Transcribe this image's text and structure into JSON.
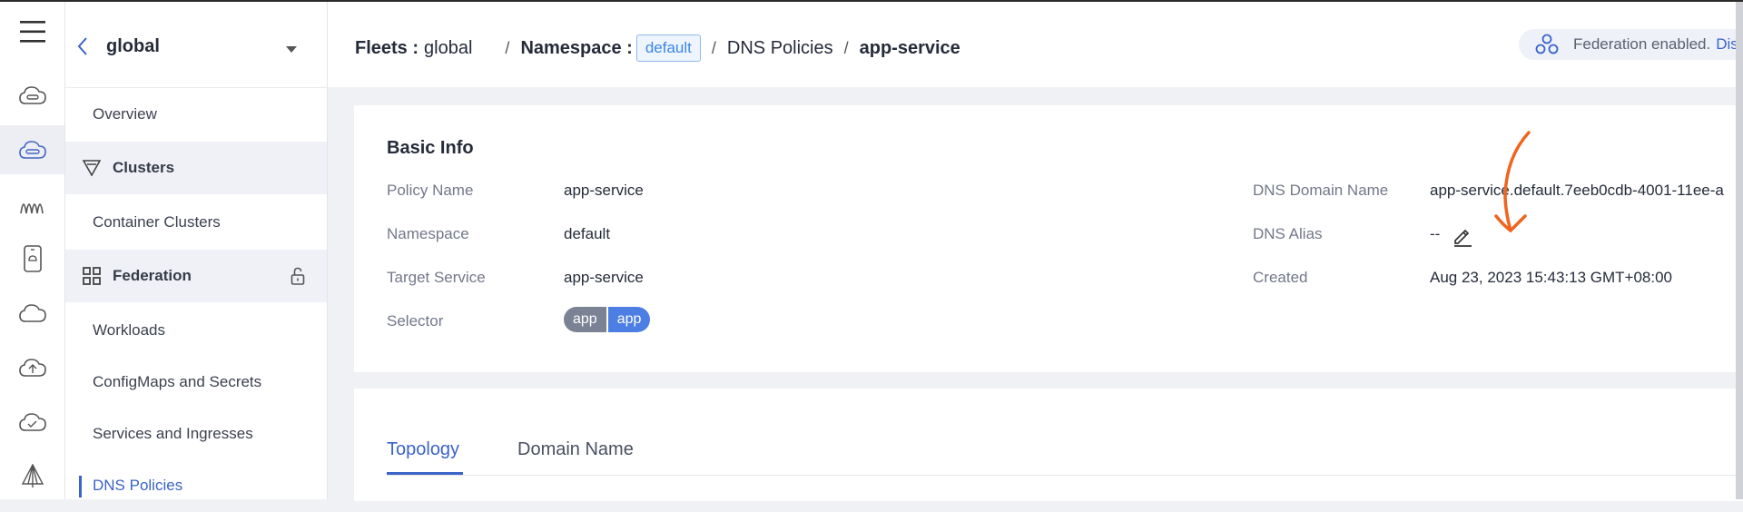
{
  "rail": {
    "icons": [
      "menu-icon",
      "cloud-icon",
      "cloud-fleet-icon",
      "waves-icon",
      "device-icon",
      "cloud-outline-icon",
      "cloud-upload-icon",
      "cloud-check-icon",
      "sail-icon"
    ]
  },
  "nav": {
    "header_title": "global",
    "overview": "Overview",
    "clusters_group": "Clusters",
    "container_clusters": "Container Clusters",
    "federation_group": "Federation",
    "workloads": "Workloads",
    "configmaps": "ConfigMaps and Secrets",
    "services": "Services and Ingresses",
    "dns_policies": "DNS Policies"
  },
  "breadcrumb": {
    "fleets_label": "Fleets :",
    "fleets_value": "global",
    "namespace_label": "Namespace :",
    "namespace_value": "default",
    "dns_policies": "DNS Policies",
    "current": "app-service"
  },
  "banner": {
    "text": "Federation enabled.",
    "link": "Dis"
  },
  "basic_info": {
    "title": "Basic Info",
    "policy_name_label": "Policy Name",
    "policy_name": "app-service",
    "namespace_label": "Namespace",
    "namespace": "default",
    "target_service_label": "Target Service",
    "target_service": "app-service",
    "selector_label": "Selector",
    "selector_key": "app",
    "selector_value": "app",
    "dns_domain_label": "DNS Domain Name",
    "dns_domain": "app-service.default.7eeb0cdb-4001-11ee-a",
    "dns_alias_label": "DNS Alias",
    "dns_alias": "--",
    "created_label": "Created",
    "created": "Aug 23, 2023 15:43:13 GMT+08:00"
  },
  "tabs": {
    "topology": "Topology",
    "domain_name": "Domain Name"
  },
  "colors": {
    "accent": "#3b63c9",
    "annotation": "#f0641e"
  }
}
